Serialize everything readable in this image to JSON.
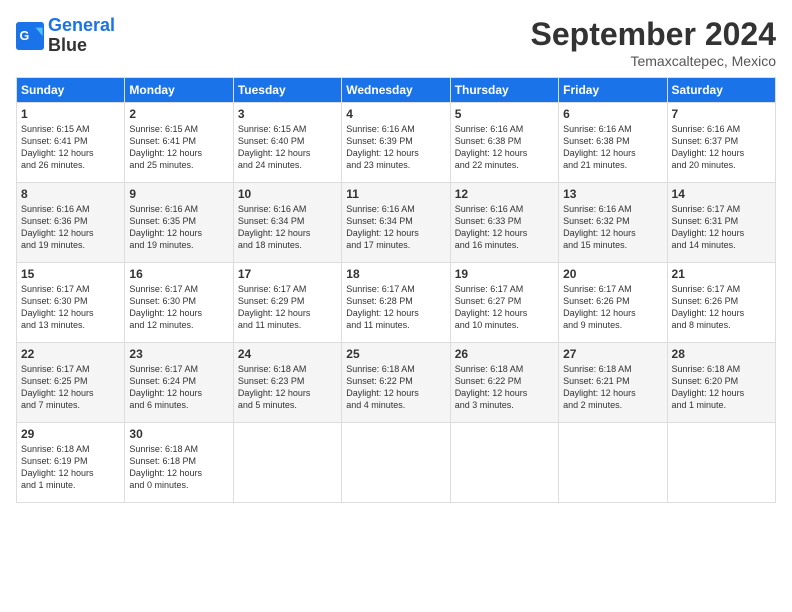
{
  "header": {
    "logo_line1": "General",
    "logo_line2": "Blue",
    "month": "September 2024",
    "location": "Temaxcaltepec, Mexico"
  },
  "days_of_week": [
    "Sunday",
    "Monday",
    "Tuesday",
    "Wednesday",
    "Thursday",
    "Friday",
    "Saturday"
  ],
  "weeks": [
    [
      {
        "day": "1",
        "sunrise": "6:15 AM",
        "sunset": "6:41 PM",
        "daylight": "12 hours and 26 minutes."
      },
      {
        "day": "2",
        "sunrise": "6:15 AM",
        "sunset": "6:41 PM",
        "daylight": "12 hours and 25 minutes."
      },
      {
        "day": "3",
        "sunrise": "6:15 AM",
        "sunset": "6:40 PM",
        "daylight": "12 hours and 24 minutes."
      },
      {
        "day": "4",
        "sunrise": "6:16 AM",
        "sunset": "6:39 PM",
        "daylight": "12 hours and 23 minutes."
      },
      {
        "day": "5",
        "sunrise": "6:16 AM",
        "sunset": "6:38 PM",
        "daylight": "12 hours and 22 minutes."
      },
      {
        "day": "6",
        "sunrise": "6:16 AM",
        "sunset": "6:38 PM",
        "daylight": "12 hours and 21 minutes."
      },
      {
        "day": "7",
        "sunrise": "6:16 AM",
        "sunset": "6:37 PM",
        "daylight": "12 hours and 20 minutes."
      }
    ],
    [
      {
        "day": "8",
        "sunrise": "6:16 AM",
        "sunset": "6:36 PM",
        "daylight": "12 hours and 19 minutes."
      },
      {
        "day": "9",
        "sunrise": "6:16 AM",
        "sunset": "6:35 PM",
        "daylight": "12 hours and 19 minutes."
      },
      {
        "day": "10",
        "sunrise": "6:16 AM",
        "sunset": "6:34 PM",
        "daylight": "12 hours and 18 minutes."
      },
      {
        "day": "11",
        "sunrise": "6:16 AM",
        "sunset": "6:34 PM",
        "daylight": "12 hours and 17 minutes."
      },
      {
        "day": "12",
        "sunrise": "6:16 AM",
        "sunset": "6:33 PM",
        "daylight": "12 hours and 16 minutes."
      },
      {
        "day": "13",
        "sunrise": "6:16 AM",
        "sunset": "6:32 PM",
        "daylight": "12 hours and 15 minutes."
      },
      {
        "day": "14",
        "sunrise": "6:17 AM",
        "sunset": "6:31 PM",
        "daylight": "12 hours and 14 minutes."
      }
    ],
    [
      {
        "day": "15",
        "sunrise": "6:17 AM",
        "sunset": "6:30 PM",
        "daylight": "12 hours and 13 minutes."
      },
      {
        "day": "16",
        "sunrise": "6:17 AM",
        "sunset": "6:30 PM",
        "daylight": "12 hours and 12 minutes."
      },
      {
        "day": "17",
        "sunrise": "6:17 AM",
        "sunset": "6:29 PM",
        "daylight": "12 hours and 11 minutes."
      },
      {
        "day": "18",
        "sunrise": "6:17 AM",
        "sunset": "6:28 PM",
        "daylight": "12 hours and 11 minutes."
      },
      {
        "day": "19",
        "sunrise": "6:17 AM",
        "sunset": "6:27 PM",
        "daylight": "12 hours and 10 minutes."
      },
      {
        "day": "20",
        "sunrise": "6:17 AM",
        "sunset": "6:26 PM",
        "daylight": "12 hours and 9 minutes."
      },
      {
        "day": "21",
        "sunrise": "6:17 AM",
        "sunset": "6:26 PM",
        "daylight": "12 hours and 8 minutes."
      }
    ],
    [
      {
        "day": "22",
        "sunrise": "6:17 AM",
        "sunset": "6:25 PM",
        "daylight": "12 hours and 7 minutes."
      },
      {
        "day": "23",
        "sunrise": "6:17 AM",
        "sunset": "6:24 PM",
        "daylight": "12 hours and 6 minutes."
      },
      {
        "day": "24",
        "sunrise": "6:18 AM",
        "sunset": "6:23 PM",
        "daylight": "12 hours and 5 minutes."
      },
      {
        "day": "25",
        "sunrise": "6:18 AM",
        "sunset": "6:22 PM",
        "daylight": "12 hours and 4 minutes."
      },
      {
        "day": "26",
        "sunrise": "6:18 AM",
        "sunset": "6:22 PM",
        "daylight": "12 hours and 3 minutes."
      },
      {
        "day": "27",
        "sunrise": "6:18 AM",
        "sunset": "6:21 PM",
        "daylight": "12 hours and 2 minutes."
      },
      {
        "day": "28",
        "sunrise": "6:18 AM",
        "sunset": "6:20 PM",
        "daylight": "12 hours and 1 minute."
      }
    ],
    [
      {
        "day": "29",
        "sunrise": "6:18 AM",
        "sunset": "6:19 PM",
        "daylight": "12 hours and 1 minute."
      },
      {
        "day": "30",
        "sunrise": "6:18 AM",
        "sunset": "6:18 PM",
        "daylight": "12 hours and 0 minutes."
      },
      null,
      null,
      null,
      null,
      null
    ]
  ]
}
